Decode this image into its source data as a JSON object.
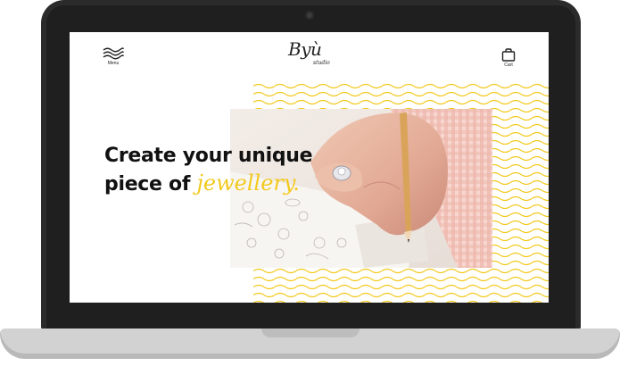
{
  "header": {
    "menu_label": "Menu",
    "cart_label": "Cart",
    "logo_text": "Byù",
    "logo_sub": "studio"
  },
  "hero": {
    "line1": "Create your unique",
    "line2_prefix": "piece of ",
    "line2_script": "jewellery."
  },
  "colors": {
    "accent": "#f2c91e",
    "text": "#111111",
    "laptop_frame": "#2b2b2b",
    "laptop_base": "#d2d2d2"
  },
  "icons": {
    "menu": "waves-icon",
    "cart": "shopping-bag-icon",
    "camera": "webcam-dot"
  }
}
